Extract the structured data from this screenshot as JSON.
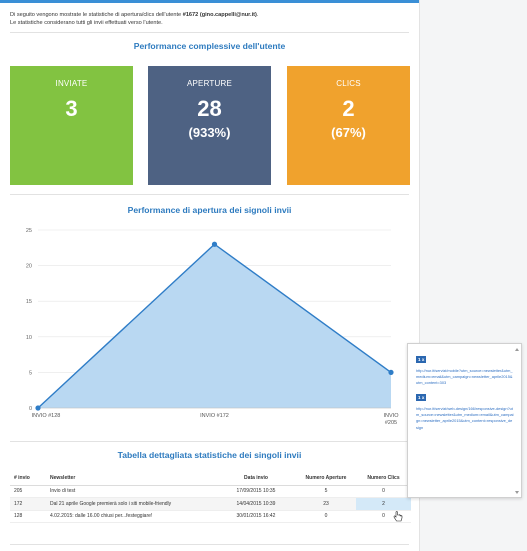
{
  "intro": {
    "line1_pre": "Di seguito vengono mostrate le statistiche di apertura/clics dell'utente ",
    "user_id": "#1672",
    "user_email": "(gino.cappelli@nur.it)",
    "line1_post": ".",
    "line2": "Le statistiche considerano tutti gli invii effettuati verso l'utente."
  },
  "performance": {
    "title": "Performance complessive dell'utente",
    "cards": [
      {
        "label": "INVIATE",
        "value": "3",
        "pct": "",
        "color": "#82c341"
      },
      {
        "label": "APERTURE",
        "value": "28",
        "pct": "(933%)",
        "color": "#4e6283"
      },
      {
        "label": "CLICS",
        "value": "2",
        "pct": "(67%)",
        "color": "#f0a22d"
      }
    ]
  },
  "chart_section": {
    "title": "Performance di apertura dei signoli invii"
  },
  "chart_data": {
    "type": "area",
    "title": "",
    "xlabel": "",
    "ylabel": "",
    "categories": [
      "INVIO #128",
      "INVIO #172",
      "INVIO #205"
    ],
    "series": [
      {
        "values": [
          0,
          23,
          5
        ]
      }
    ],
    "ylim": [
      0,
      25
    ],
    "yticks": [
      "0",
      "5",
      "10",
      "15",
      "20",
      "25"
    ],
    "grid": true,
    "fill_color": "#b9d8f2",
    "line_color": "#2f7dc7"
  },
  "table_section": {
    "title": "Tabella dettagliata statistiche dei singoli invii",
    "headers": [
      "# invio",
      "Newsletter",
      "Data invio",
      "Numero Aperture",
      "Numero Clics"
    ],
    "rows": [
      [
        "205",
        "Invio di test",
        "17/09/2015 10:35",
        "5",
        "0"
      ],
      [
        "172",
        "Dal 21 aprile Google premierà solo i siti mobile-friendly",
        "14/04/2015 10:39",
        "23",
        "2"
      ],
      [
        "128",
        "4.02.2015: dalle 16.00 chiusi per...festeggiare!",
        "30/01/2015 16:42",
        "0",
        "0"
      ]
    ]
  },
  "tooltip": {
    "entries": [
      {
        "badge": "1 x",
        "url": "http://nur.it/servizi/mobile?utm_source=newsletter&utm_medium=email&utm_campaign=newsletter_aprile2015&utm_content=303"
      },
      {
        "badge": "1 x",
        "url": "http://nur.it/servizi/web-design/166/responsive-design?utm_source=newsletter&utm_medium=email&utm_campaign=newsletter_aprile2015&utm_content=responsive_design"
      }
    ]
  }
}
